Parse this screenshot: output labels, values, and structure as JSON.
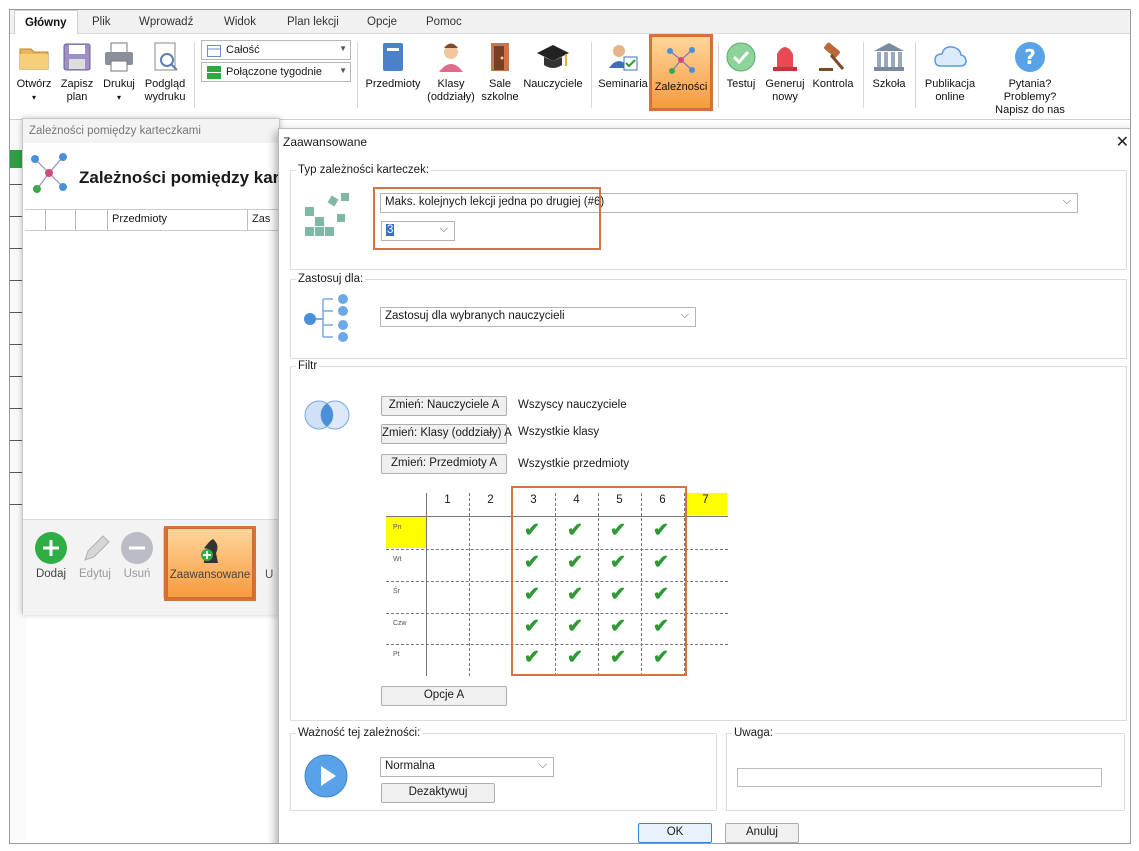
{
  "menu": {
    "tabs": [
      "Główny",
      "Plik",
      "Wprowadź",
      "Widok",
      "Plan lekcji",
      "Opcje",
      "Pomoc"
    ]
  },
  "ribbon": {
    "open": "Otwórz",
    "save": "Zapisz\nplan",
    "print": "Drukuj",
    "preview": "Podgląd\nwydruku",
    "combo_scope": "Całość",
    "combo_weeks": "Połączone tygodnie",
    "subjects": "Przedmioty",
    "classes": "Klasy\n(oddziały)",
    "rooms": "Sale\nszkolne",
    "teachers": "Nauczyciele",
    "seminars": "Seminaria",
    "dependencies": "Zależności",
    "test": "Testuj",
    "generate": "Generuj\nnowy",
    "control": "Kontrola",
    "school": "Szkoła",
    "publish": "Publikacja\nonline",
    "help": "Pytania? Problemy?\nNapisz do nas"
  },
  "left_panel": {
    "window_title": "Zależności pomiędzy karteczkami",
    "heading": "Zależności pomiędzy kar",
    "col_subjects": "Przedmioty",
    "col_zas": "Zas",
    "add": "Dodaj",
    "edit": "Edytuj",
    "remove": "Usuń",
    "advanced": "Zaawansowane",
    "cut_letter": "U"
  },
  "dialog": {
    "title": "Zaawansowane",
    "type_group": "Typ zależności karteczek:",
    "type_value": "Maks. kolejnych lekcji jedna po drugiej (#6)",
    "count_value": "3",
    "apply_group": "Zastosuj dla:",
    "apply_value": "Zastosuj dla wybranych nauczycieli",
    "filter_group": "Filtr",
    "btn_teachers": "Zmień: Nauczyciele A",
    "txt_teachers": "Wszyscy nauczyciele",
    "btn_classes": "Zmień: Klasy (oddziały) A",
    "txt_classes": "Wszystkie klasy",
    "btn_subjects": "Zmień: Przedmioty A",
    "txt_subjects": "Wszystkie przedmioty",
    "grid_periods": [
      "1",
      "2",
      "3",
      "4",
      "5",
      "6",
      "7"
    ],
    "grid_days": [
      "Pn",
      "Wt",
      "Śr",
      "Czw",
      "Pt"
    ],
    "checked_periods": [
      3,
      4,
      5,
      6
    ],
    "options_btn": "Opcje A",
    "importance_group": "Ważność tej zależności:",
    "importance_value": "Normalna",
    "deactivate": "Dezaktywuj",
    "note_group": "Uwaga:",
    "note_value": "",
    "ok": "OK",
    "cancel": "Anuluj"
  },
  "colors": {
    "highlight_frame": "#d27441",
    "ribbon_active": "#f79b3e",
    "check": "#2e9a32",
    "yellow": "#ffff00",
    "accent_blue": "#4a90d9"
  }
}
